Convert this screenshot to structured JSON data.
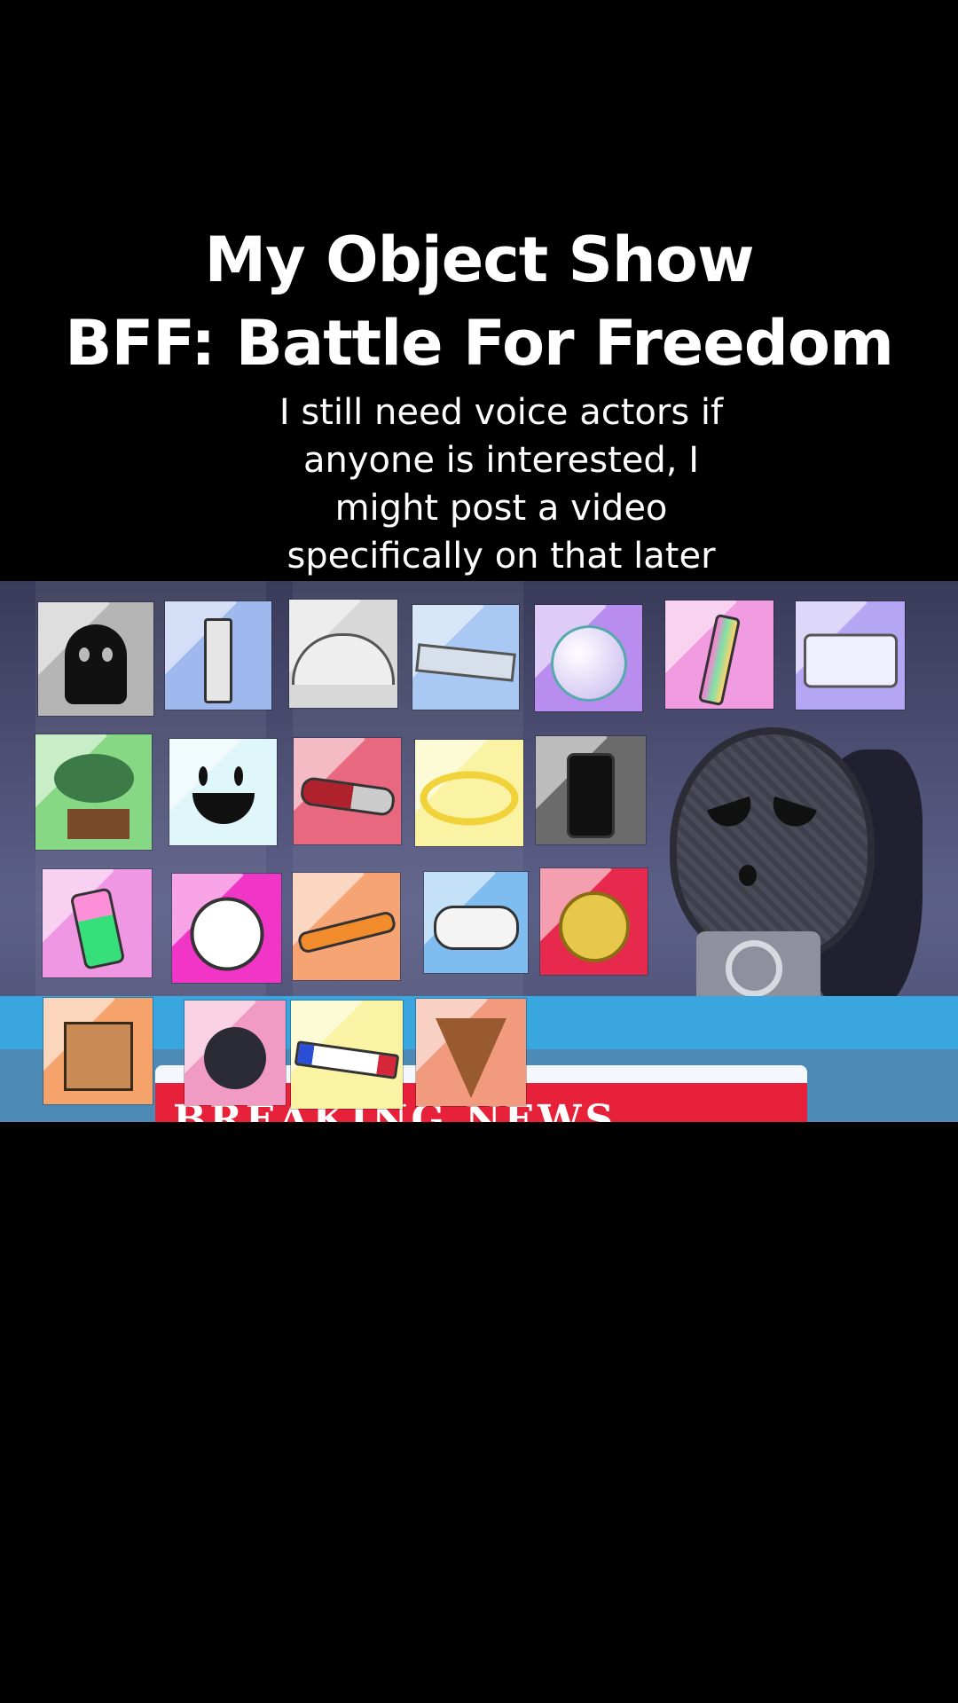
{
  "title": {
    "line1": "My Object Show",
    "line2": "BFF: Battle For Freedom"
  },
  "caption": {
    "line1": "I still need voice actors if",
    "line2": "anyone is interested, I",
    "line3": "might post a video",
    "line4": "specifically on that later"
  },
  "background": {
    "banner_text": "BREAKING NEWS"
  },
  "colors": {
    "page": "#000000",
    "scene": "#4e5075",
    "band": "#39a6df",
    "banner": "#e8213b"
  },
  "tiles": [
    {
      "icon": "black-ghost-icon",
      "bg": "#b5b5b5"
    },
    {
      "icon": "syringe-icon",
      "bg": "#9fb9ee"
    },
    {
      "icon": "protractor-icon",
      "bg": "#d8d8d8"
    },
    {
      "icon": "ruler-icon",
      "bg": "#a9c8f4"
    },
    {
      "icon": "bubble-icon",
      "bg": "#b98cf0"
    },
    {
      "icon": "pencil-icon",
      "bg": "#f19be0"
    },
    {
      "icon": "stapler-icon",
      "bg": "#b4a6f3"
    },
    {
      "icon": "bonsai-icon",
      "bg": "#86d884"
    },
    {
      "icon": "ice-cube-icon",
      "bg": "#dff7fb"
    },
    {
      "icon": "screwdriver-icon",
      "bg": "#e8687f"
    },
    {
      "icon": "halo-ring-icon",
      "bg": "#fbf3a4"
    },
    {
      "icon": "phone-icon",
      "bg": "#6b6b6b"
    },
    {
      "icon": "battery-icon",
      "bg": "#ef97e2"
    },
    {
      "icon": "clock-icon",
      "bg": "#f035c7"
    },
    {
      "icon": "airplane-icon",
      "bg": "#f7a474"
    },
    {
      "icon": "earbud-icon",
      "bg": "#7fbdf0"
    },
    {
      "icon": "coin-icon",
      "bg": "#e8294e"
    },
    {
      "icon": "cardboard-box-icon",
      "bg": "#f5a36a"
    },
    {
      "icon": "yarn-ball-icon",
      "bg": "#f19bc4"
    },
    {
      "icon": "marker-icon",
      "bg": "#fbf3a4"
    },
    {
      "icon": "spinning-top-icon",
      "bg": "#f29a7d"
    }
  ]
}
